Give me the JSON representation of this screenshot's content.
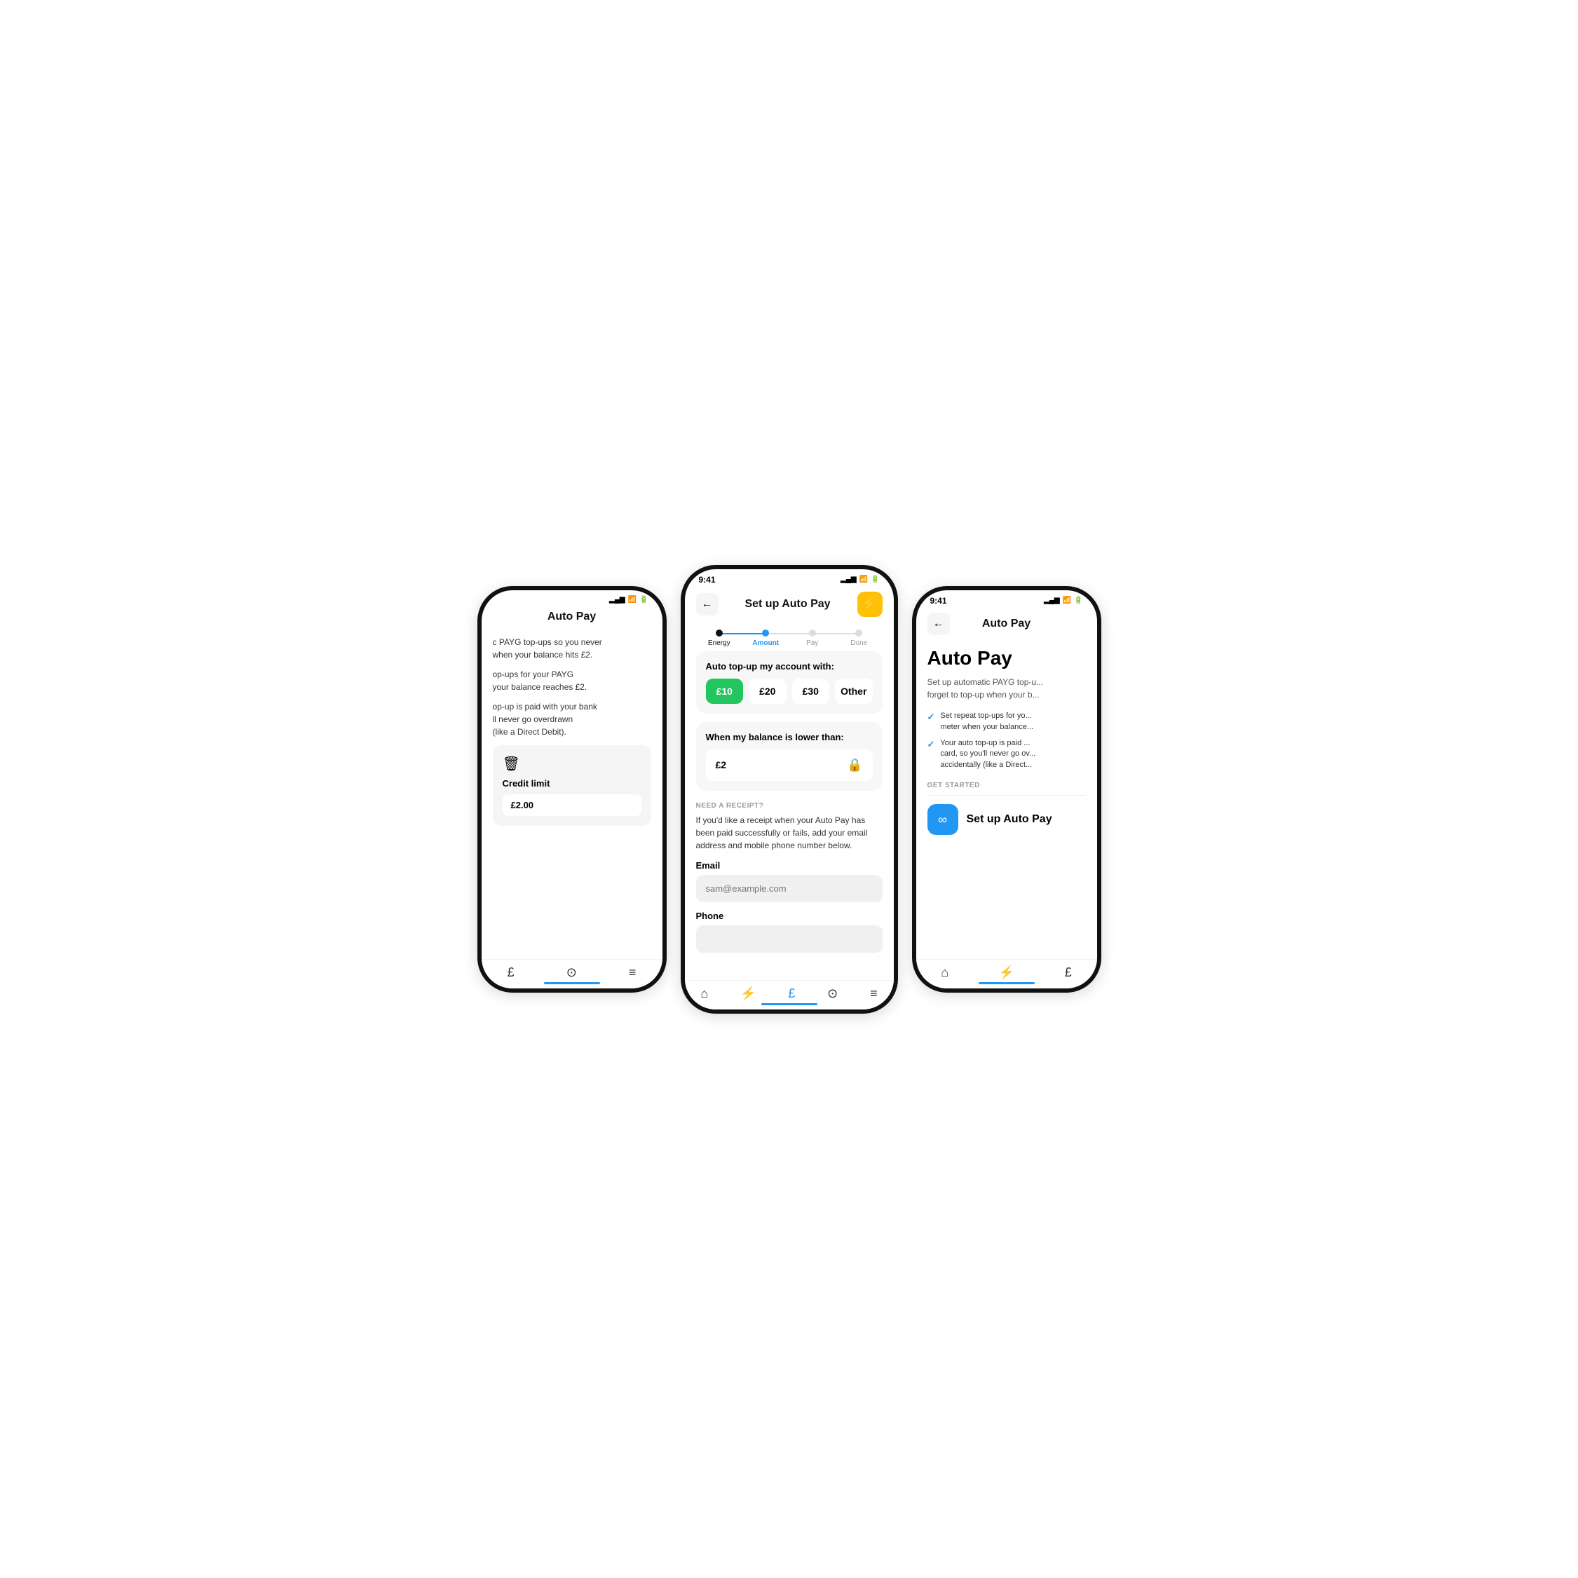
{
  "left_phone": {
    "title": "Auto Pay",
    "body_text_1": "c PAYG top-ups so you never\nwhen your balance hits £2.",
    "body_text_2": "op-ups for your PAYG\nyour balance reaches £2.",
    "body_text_3": "op-up is paid with your bank\nll never go overdrawn\n(like a Direct Debit).",
    "credit_limit_label": "Credit limit",
    "credit_amount": "£2.00",
    "nav_icons": [
      "£",
      "?",
      "≡"
    ]
  },
  "center_phone": {
    "status_time": "9:41",
    "nav_title": "Set up Auto Pay",
    "back_label": "←",
    "lightning_icon": "⚡",
    "stepper": {
      "steps": [
        {
          "label": "Energy",
          "state": "done"
        },
        {
          "label": "Amount",
          "state": "active"
        },
        {
          "label": "Pay",
          "state": "inactive"
        },
        {
          "label": "Done",
          "state": "inactive"
        }
      ]
    },
    "top_up_section": {
      "title": "Auto top-up my account with:",
      "options": [
        "£10",
        "£20",
        "£30",
        "Other"
      ],
      "selected_index": 0
    },
    "balance_section": {
      "title": "When my balance is lower than:",
      "value": "£2"
    },
    "receipt_section": {
      "label": "NEED A RECEIPT?",
      "description": "If you'd like a receipt when your Auto Pay has been paid successfully or fails, add your email address and mobile phone number below."
    },
    "email_field": {
      "label": "Email",
      "placeholder": "sam@example.com"
    },
    "phone_field": {
      "label": "Phone",
      "placeholder": ""
    },
    "nav_icons": [
      "🏠",
      "⚡",
      "£",
      "?",
      "≡"
    ]
  },
  "right_phone": {
    "status_time": "9:41",
    "nav_title": "Auto Pay",
    "back_label": "←",
    "page_title": "Auto Pay",
    "description": "Set up automatic PAYG top-u... forget to top-up when your b...",
    "checklist": [
      "Set repeat top-ups for yo... meter when your balance...",
      "Your auto top-up is paid ... card, so you'll never go ov... accidentally (like a Direct..."
    ],
    "get_started_label": "GET STARTED",
    "setup_btn_label": "Set up Auto Pay",
    "infinity_symbol": "∞",
    "nav_icons": [
      "🏠",
      "⚡",
      "£"
    ]
  }
}
